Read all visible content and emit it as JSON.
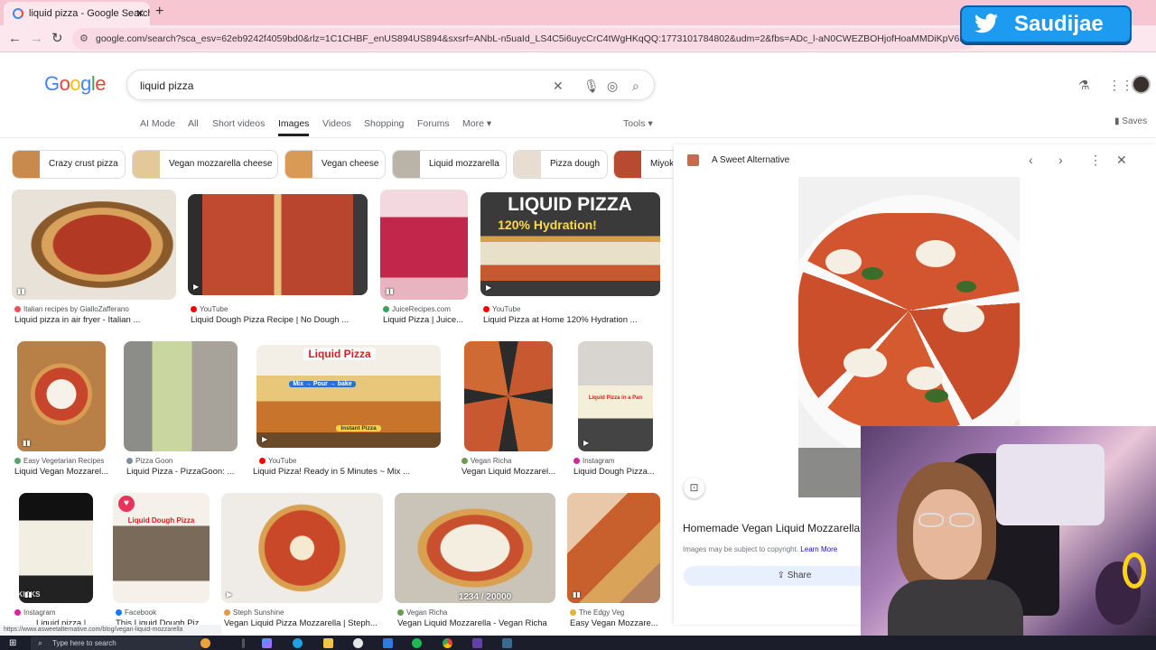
{
  "browser": {
    "tab_title": "liquid pizza - Google Search",
    "url": "google.com/search?sca_esv=62eb9242f4059bd0&rlz=1C1CHBF_enUS894US894&sxsrf=ANbL-n5uaId_LS4C5i6uycCrC4tWgHKqQQ:1773101784802&udm=2&fbs=ADc_l-aN0CWEZBOHjofHoaMMDiKpV6Bbbmx4QVaoKkiRQ2jlwvMg",
    "status_url": "https://www.asweetalternative.com/blog/vegan-liquid-mozzarella"
  },
  "overlay": {
    "twitter_handle": "Saudijae"
  },
  "google": {
    "logo": [
      "G",
      "o",
      "o",
      "g",
      "l",
      "e"
    ],
    "query": "liquid pizza",
    "tabs": [
      "AI Mode",
      "All",
      "Short videos",
      "Images",
      "Videos",
      "Shopping",
      "Forums",
      "More"
    ],
    "active_tab": "Images",
    "tools_label": "Tools",
    "saves_label": "Saves"
  },
  "chips": [
    {
      "label": "Crazy crust pizza",
      "color": "#c98a4e"
    },
    {
      "label": "Vegan mozzarella cheese",
      "color": "#e3c89a"
    },
    {
      "label": "Vegan cheese",
      "color": "#d99a55"
    },
    {
      "label": "Liquid mozzarella",
      "color": "#b9b3a8"
    },
    {
      "label": "Pizza dough",
      "color": "#e7ddd0"
    },
    {
      "label": "Miyok",
      "color": "#b84a32"
    }
  ],
  "results": [
    {
      "source": "Italian recipes by GialloZafferano",
      "title": "Liquid pizza in air fryer - Italian ...",
      "dot": "#e8505b",
      "badge": "short"
    },
    {
      "source": "YouTube",
      "title": "Liquid Dough Pizza Recipe | No Dough ...",
      "dot": "#ff0000",
      "badge": "play"
    },
    {
      "source": "JuiceRecipes.com",
      "title": "Liquid Pizza | Juice...",
      "dot": "#3aa05a",
      "badge": "short"
    },
    {
      "source": "YouTube",
      "title": "Liquid Pizza at Home 120% Hydration ...",
      "dot": "#ff0000",
      "badge": "play",
      "overlay_line1": "LIQUID PIZZA",
      "overlay_line2": "120% Hydration!"
    },
    {
      "source": "Easy Vegetarian Recipes",
      "title": "Liquid Vegan Mozzarel...",
      "dot": "#5aa469",
      "badge": "short"
    },
    {
      "source": "Pizza Goon",
      "title": "Liquid Pizza - PizzaGoon: ...",
      "dot": "#7b8ea3",
      "badge": ""
    },
    {
      "source": "YouTube",
      "title": "Liquid Pizza! Ready in 5 Minutes ~ Mix ...",
      "dot": "#ff0000",
      "badge": "play",
      "overlay_line1": "Liquid Pizza",
      "overlay_line2": "Mix → Pour → bake",
      "overlay_line3": "Instant Pizza"
    },
    {
      "source": "Vegan Richa",
      "title": "Vegan Liquid Mozzarel...",
      "dot": "#6c9b4f",
      "badge": ""
    },
    {
      "source": "Instagram",
      "title": "Liquid Dough Pizza...",
      "dot": "#d6249f",
      "badge": "play",
      "overlay_line1": "Liquid Pizza in a Pan"
    },
    {
      "source": "Instagram",
      "title": "Liquid pizza | ...",
      "dot": "#d6249f",
      "badge": "short",
      "overlay_line1": "KICKS"
    },
    {
      "source": "Facebook",
      "title": "This Liquid Dough Piz...",
      "dot": "#1877f2",
      "badge": "",
      "overlay_line1": "Liquid Dough Pizza"
    },
    {
      "source": "Steph Sunshine",
      "title": "Vegan Liquid Pizza Mozzarella | Steph...",
      "dot": "#e29a4a",
      "badge": "play"
    },
    {
      "source": "Vegan Richa",
      "title": "Vegan Liquid Mozzarella - Vegan Richa",
      "dot": "#6c9b4f",
      "badge": "",
      "overlay_line1": "1234 / 20000"
    },
    {
      "source": "The Edgy Veg",
      "title": "Easy Vegan Mozzare...",
      "dot": "#e3b23c",
      "badge": "short"
    }
  ],
  "panel": {
    "site": "A Sweet Alternative",
    "heading": "Homemade Vegan Liquid Mozzarella",
    "copyright": "Images may be subject to copyright.",
    "learn_more": "Learn More",
    "share": "Share"
  },
  "taskbar": {
    "search_placeholder": "Type here to search"
  }
}
